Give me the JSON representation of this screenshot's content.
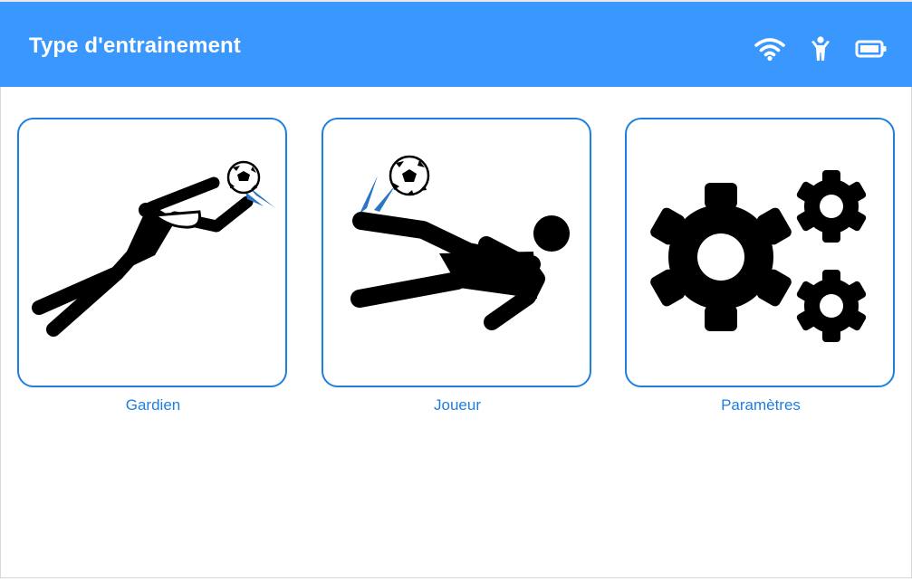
{
  "header": {
    "title": "Type d'entrainement",
    "background_color": "#3a97fd",
    "status_icons": [
      "wifi-icon",
      "person-icon",
      "battery-icon"
    ]
  },
  "cards": [
    {
      "label": "Gardien",
      "icon": "goalkeeper-dive-icon"
    },
    {
      "label": "Joueur",
      "icon": "player-kick-icon"
    },
    {
      "label": "Paramètres",
      "icon": "gears-icon"
    }
  ],
  "accent_color": "#1e7fe0"
}
